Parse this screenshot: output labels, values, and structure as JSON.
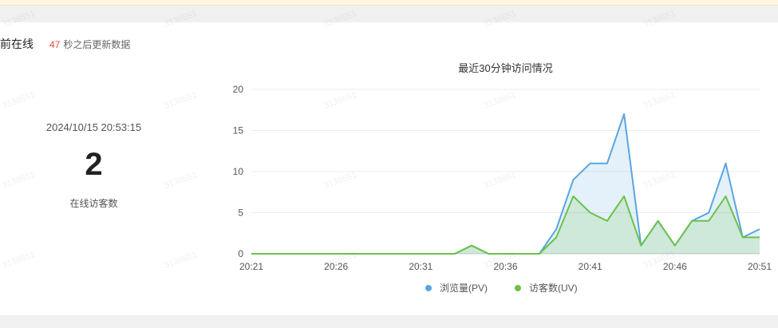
{
  "panel": {
    "title": "前在线",
    "countdown_seconds": "47",
    "countdown_text": "秒之后更新数据"
  },
  "stats": {
    "datetime": "2024/10/15 20:53:15",
    "online_count": "2",
    "online_label": "在线访客数"
  },
  "watermark_text": "3138651",
  "colors": {
    "pv": "#5aa5e0",
    "uv": "#6cc24a",
    "countdown": "#e54d42"
  },
  "chart_data": {
    "type": "area",
    "title": "最近30分钟访问情况",
    "x": [
      "20:21",
      "20:22",
      "20:23",
      "20:24",
      "20:25",
      "20:26",
      "20:27",
      "20:28",
      "20:29",
      "20:30",
      "20:31",
      "20:32",
      "20:33",
      "20:34",
      "20:35",
      "20:36",
      "20:37",
      "20:38",
      "20:39",
      "20:40",
      "20:41",
      "20:42",
      "20:43",
      "20:44",
      "20:45",
      "20:46",
      "20:47",
      "20:48",
      "20:49",
      "20:50",
      "20:51"
    ],
    "xticks": [
      "20:21",
      "20:26",
      "20:31",
      "20:36",
      "20:41",
      "20:46",
      "20:51"
    ],
    "yticks": [
      0,
      5,
      10,
      15,
      20
    ],
    "ylim": [
      0,
      20
    ],
    "grid": true,
    "legend_position": "bottom-center",
    "series": [
      {
        "name": "浏览量(PV)",
        "values": [
          0,
          0,
          0,
          0,
          0,
          0,
          0,
          0,
          0,
          0,
          0,
          0,
          0,
          1,
          0,
          0,
          0,
          0,
          3,
          9,
          11,
          11,
          17,
          1,
          4,
          1,
          4,
          5,
          11,
          2,
          3
        ]
      },
      {
        "name": "访客数(UV)",
        "values": [
          0,
          0,
          0,
          0,
          0,
          0,
          0,
          0,
          0,
          0,
          0,
          0,
          0,
          1,
          0,
          0,
          0,
          0,
          2,
          7,
          5,
          4,
          7,
          1,
          4,
          1,
          4,
          4,
          7,
          2,
          2
        ]
      }
    ]
  }
}
